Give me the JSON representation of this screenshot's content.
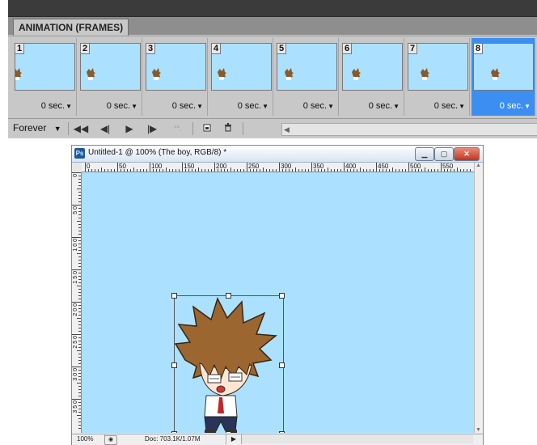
{
  "animation_panel": {
    "tab_label": "ANIMATION (FRAMES)",
    "frames": [
      {
        "number": "1",
        "delay": "0 sec.",
        "selected": false
      },
      {
        "number": "2",
        "delay": "0 sec.",
        "selected": false
      },
      {
        "number": "3",
        "delay": "0 sec.",
        "selected": false
      },
      {
        "number": "4",
        "delay": "0 sec.",
        "selected": false
      },
      {
        "number": "5",
        "delay": "0 sec.",
        "selected": false
      },
      {
        "number": "6",
        "delay": "0 sec.",
        "selected": false
      },
      {
        "number": "7",
        "delay": "0 sec.",
        "selected": false
      },
      {
        "number": "8",
        "delay": "0 sec.",
        "selected": true
      }
    ],
    "loop_option": "Forever",
    "toolbar_icons": [
      "loop-dropdown-icon",
      "first-frame-icon",
      "previous-frame-icon",
      "play-icon",
      "next-frame-icon",
      "tween-icon",
      "duplicate-frame-icon",
      "delete-frame-icon"
    ]
  },
  "document": {
    "title": "Untitled-1 @ 100% (The boy, RGB/8) *",
    "app_icon": "Ps",
    "ruler_h_labels": [
      "0",
      "50",
      "100",
      "150",
      "200",
      "250",
      "300",
      "350",
      "400",
      "450",
      "500",
      "550"
    ],
    "ruler_v_labels": [
      "0",
      "5 0",
      "1 0 0",
      "1 5 0",
      "2 0 0",
      "2 5 0",
      "3 0 0",
      "3 5 0"
    ],
    "zoom": "100%",
    "doc_info": "Doc: 703.1K/1.07M",
    "canvas_color": "#abe1ff"
  },
  "colors": {
    "selection_blue": "#3d8ef2",
    "panel_gray": "#c8c8c8",
    "canvas_blue": "#abe1ff"
  }
}
